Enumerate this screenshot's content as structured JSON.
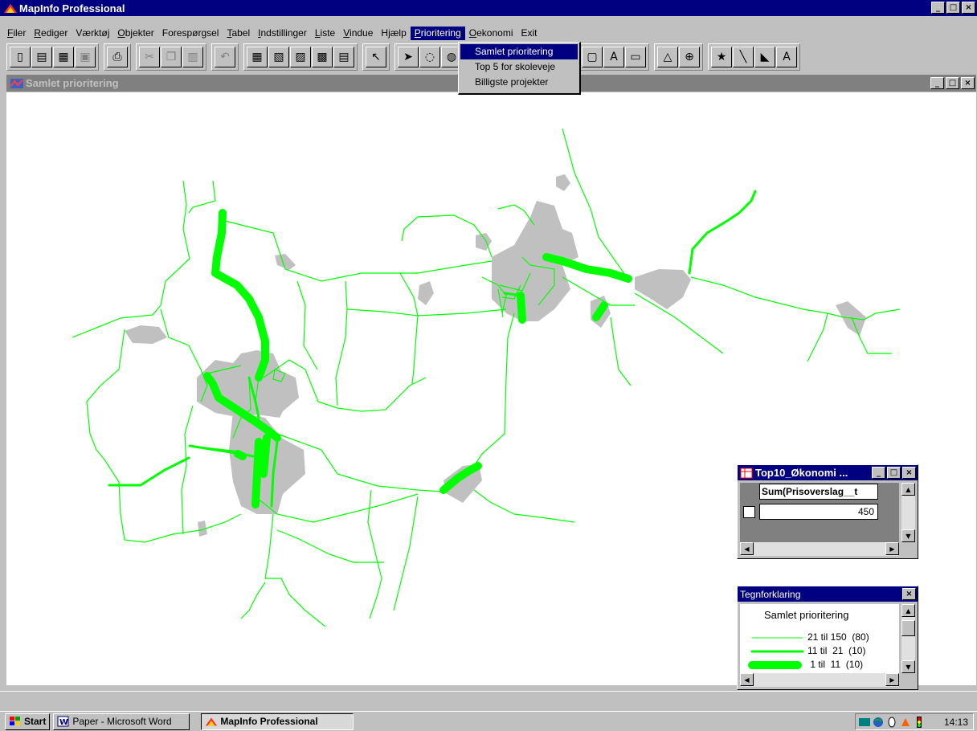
{
  "app": {
    "title": "MapInfo Professional",
    "window_buttons": [
      "_",
      "□",
      "×"
    ]
  },
  "menu": {
    "items": [
      {
        "label": "Filer",
        "accel": "F",
        "rest": "iler"
      },
      {
        "label": "Rediger",
        "accel": "R",
        "rest": "ediger"
      },
      {
        "label": "Værktøj",
        "accel": "",
        "rest": "Værktøj"
      },
      {
        "label": "Objekter",
        "accel": "O",
        "rest": "bjekter"
      },
      {
        "label": "Forespørgsel",
        "accel": "",
        "rest": "Forespørgsel"
      },
      {
        "label": "Tabel",
        "accel": "T",
        "rest": "abel"
      },
      {
        "label": "Indstillinger",
        "accel": "I",
        "rest": "ndstillinger"
      },
      {
        "label": "Liste",
        "accel": "L",
        "rest": "iste"
      },
      {
        "label": "Vindue",
        "accel": "V",
        "rest": "indue"
      },
      {
        "label": "Hjælp",
        "accel": "",
        "rest": "Hjælp"
      },
      {
        "label": "Prioritering",
        "accel": "P",
        "rest": "rioritering",
        "active": true
      },
      {
        "label": "Oekonomi",
        "accel": "O",
        "rest": "ekonomi"
      },
      {
        "label": "Exit",
        "accel": "",
        "rest": "Exit"
      }
    ],
    "dropdown": [
      "Samlet prioritering",
      "Top 5 for skoleveje",
      "Billigste projekter"
    ],
    "dropdown_selected": 0
  },
  "toolbar": {
    "groups": [
      [
        "new-icon",
        "open-icon",
        "open-table-icon",
        "save-icon"
      ],
      [
        "print-icon"
      ],
      [
        "cut-icon",
        "copy-icon",
        "paste-icon"
      ],
      [
        "undo-icon"
      ],
      [
        "new-browser-icon",
        "new-mapper-icon",
        "new-grapher-icon",
        "new-layout-icon",
        "new-redistrict-icon"
      ],
      [
        "help-pointer-icon"
      ],
      [
        "select-icon",
        "radius-select-icon",
        "boundary-select-icon"
      ],
      [
        "line-icon",
        "arc-icon",
        "polygon-icon",
        "ellipse-icon",
        "rectangle-icon",
        "rounded-rect-icon",
        "text-icon",
        "frame-icon"
      ],
      [
        "reshape-icon",
        "add-node-icon"
      ],
      [
        "symbol-style-icon",
        "line-style-icon",
        "region-style-icon",
        "text-style-icon"
      ]
    ],
    "glyphs": {
      "new-icon": "▯",
      "open-icon": "▤",
      "open-table-icon": "▦",
      "save-icon": "▣",
      "print-icon": "⎙",
      "cut-icon": "✂",
      "copy-icon": "❐",
      "paste-icon": "▥",
      "undo-icon": "↶",
      "new-browser-icon": "▦",
      "new-mapper-icon": "▧",
      "new-grapher-icon": "▨",
      "new-layout-icon": "▩",
      "new-redistrict-icon": "▤",
      "help-pointer-icon": "↖",
      "select-icon": "➤",
      "radius-select-icon": "◌",
      "boundary-select-icon": "◍",
      "line-icon": "╱",
      "arc-icon": "⌒",
      "polygon-icon": "⌂",
      "ellipse-icon": "○",
      "rectangle-icon": "□",
      "rounded-rect-icon": "▢",
      "text-icon": "A",
      "frame-icon": "▭",
      "reshape-icon": "△",
      "add-node-icon": "⊕",
      "symbol-style-icon": "★",
      "line-style-icon": "╲",
      "region-style-icon": "◣",
      "text-style-icon": "A"
    }
  },
  "map_window": {
    "title": "Samlet prioritering",
    "buttons": [
      "_",
      "□",
      "×"
    ],
    "colors": {
      "road": "#00ff00",
      "urban_area": "#c0c0c0"
    }
  },
  "browser_window": {
    "title": "Top10_Økonomi ...",
    "column_header": "Sum(Prisoverslag__t",
    "row_value": "450",
    "buttons": [
      "_",
      "□",
      "×"
    ]
  },
  "legend_window": {
    "title": "Tegnforklaring",
    "close": "×",
    "heading": "Samlet prioritering",
    "rows": [
      {
        "label": "21 til 150  (80)",
        "stroke": 1
      },
      {
        "label": "11 til  21  (10)",
        "stroke": 3
      },
      {
        "label": " 1 til  11  (10)",
        "stroke": 10
      }
    ]
  },
  "taskbar": {
    "start": "Start",
    "buttons": [
      {
        "label": "Paper - Microsoft Word",
        "pressed": false
      },
      {
        "label": "MapInfo Professional",
        "pressed": true
      }
    ],
    "clock": "14:13"
  }
}
